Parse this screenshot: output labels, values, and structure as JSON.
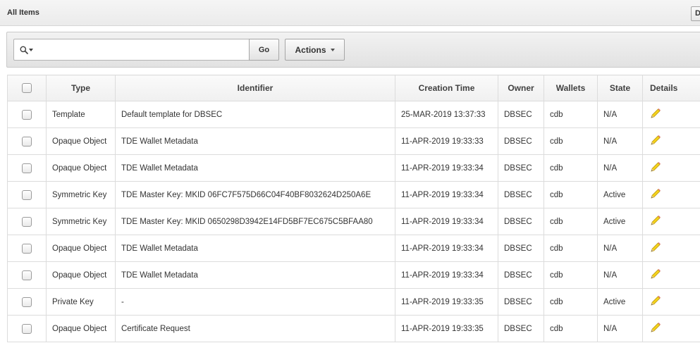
{
  "region": {
    "title": "All Items",
    "button_label": "D"
  },
  "search": {
    "placeholder": "",
    "value": "",
    "go_label": "Go",
    "actions_label": "Actions"
  },
  "table": {
    "columns": {
      "type": "Type",
      "identifier": "Identifier",
      "creation_time": "Creation Time",
      "owner": "Owner",
      "wallets": "Wallets",
      "state": "State",
      "details": "Details"
    },
    "rows": [
      {
        "type": "Template",
        "identifier": "Default template for DBSEC",
        "creation_time": "25-MAR-2019 13:37:33",
        "owner": "DBSEC",
        "wallets": "cdb",
        "state": "N/A"
      },
      {
        "type": "Opaque Object",
        "identifier": "TDE Wallet Metadata",
        "creation_time": "11-APR-2019 19:33:33",
        "owner": "DBSEC",
        "wallets": "cdb",
        "state": "N/A"
      },
      {
        "type": "Opaque Object",
        "identifier": "TDE Wallet Metadata",
        "creation_time": "11-APR-2019 19:33:34",
        "owner": "DBSEC",
        "wallets": "cdb",
        "state": "N/A"
      },
      {
        "type": "Symmetric Key",
        "identifier": "TDE Master Key: MKID 06FC7F575D66C04F40BF8032624D250A6E",
        "creation_time": "11-APR-2019 19:33:34",
        "owner": "DBSEC",
        "wallets": "cdb",
        "state": "Active"
      },
      {
        "type": "Symmetric Key",
        "identifier": "TDE Master Key: MKID 0650298D3942E14FD5BF7EC675C5BFAA80",
        "creation_time": "11-APR-2019 19:33:34",
        "owner": "DBSEC",
        "wallets": "cdb",
        "state": "Active"
      },
      {
        "type": "Opaque Object",
        "identifier": "TDE Wallet Metadata",
        "creation_time": "11-APR-2019 19:33:34",
        "owner": "DBSEC",
        "wallets": "cdb",
        "state": "N/A"
      },
      {
        "type": "Opaque Object",
        "identifier": "TDE Wallet Metadata",
        "creation_time": "11-APR-2019 19:33:34",
        "owner": "DBSEC",
        "wallets": "cdb",
        "state": "N/A"
      },
      {
        "type": "Private Key",
        "identifier": "-",
        "creation_time": "11-APR-2019 19:33:35",
        "owner": "DBSEC",
        "wallets": "cdb",
        "state": "Active"
      },
      {
        "type": "Opaque Object",
        "identifier": "Certificate Request",
        "creation_time": "11-APR-2019 19:33:35",
        "owner": "DBSEC",
        "wallets": "cdb",
        "state": "N/A"
      }
    ]
  },
  "icons": {
    "search": "search-icon",
    "dropdown": "chevron-down-icon",
    "checkbox": "checkbox-icon",
    "edit": "pencil-edit-icon"
  },
  "colors": {
    "pencil_body": "#f5d31c",
    "pencil_edge": "#b8960a",
    "border": "#dcdcdc",
    "header_bg": "#f0f0f0"
  }
}
